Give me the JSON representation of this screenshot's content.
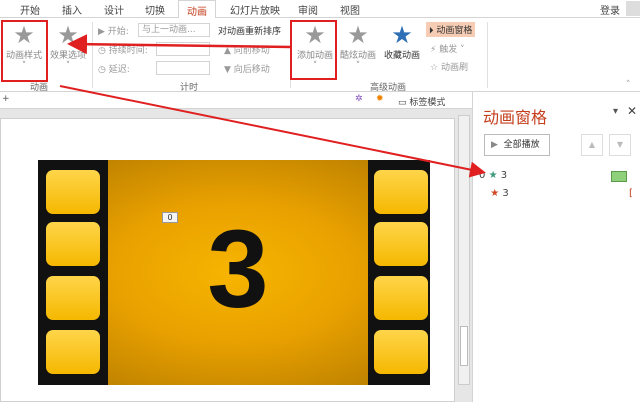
{
  "tabs": [
    "开始",
    "插入",
    "设计",
    "切换",
    "动画",
    "幻灯片放映",
    "审阅",
    "视图"
  ],
  "login": "登录",
  "ribbon": {
    "anim_style": "动画样式",
    "effect_opts": "效果选项",
    "group_anim": "动画",
    "start_label": "开始:",
    "start_value": "与上一动画...",
    "duration_label": "持续时间:",
    "delay_label": "延迟:",
    "group_timing": "计时",
    "reorder_title": "对动画重新排序",
    "move_earlier": "向前移动",
    "move_later": "向后移动",
    "add_anim": "添加动画",
    "custom_anim": "酷炫动画",
    "fav_anim": "收藏动画",
    "anim_pane": "动画窗格",
    "trigger": "触发",
    "anim_painter": "动画刷",
    "group_adv": "高级动画"
  },
  "toolbar": {
    "tag_mode": "标签模式"
  },
  "slide": {
    "number": "3",
    "tag": "0"
  },
  "pane": {
    "title": "动画窗格",
    "play_all": "全部播放",
    "items": [
      {
        "index": "0",
        "name": "3",
        "color": "#3a9a7a"
      },
      {
        "index": "",
        "name": "3",
        "color": "#d04a2a"
      }
    ]
  },
  "colors": {
    "accent": "#c43e1c",
    "highlight": "#e02020"
  }
}
